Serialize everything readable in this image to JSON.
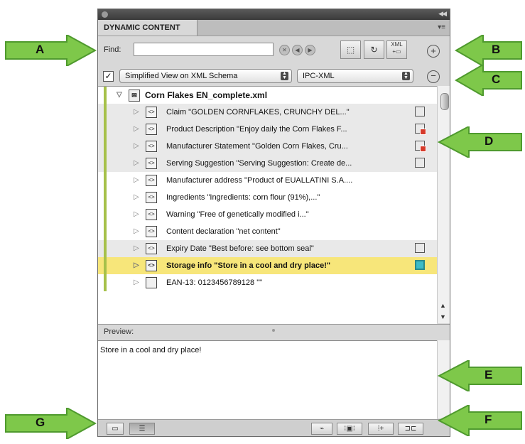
{
  "panel": {
    "tab_label": "DYNAMIC CONTENT",
    "menu_glyph": "▾≡",
    "find_label": "Find:",
    "find_value": "",
    "view_checked": true,
    "schema_view": "Simplified View on XML Schema",
    "format": "IPC-XML",
    "root_file": "Corn Flakes EN_complete.xml",
    "items": [
      {
        "label": "Claim  \"GOLDEN CORNFLAKES, CRUNCHY DEL...\"",
        "shaded": true,
        "frame": "empty",
        "bar": true
      },
      {
        "label": "Product Description  \"Enjoy daily the Corn Flakes F...",
        "shaded": true,
        "frame": "linked",
        "bar": true
      },
      {
        "label": "Manufacturer Statement  \"Golden Corn Flakes, Cru...",
        "shaded": true,
        "frame": "linked",
        "bar": true
      },
      {
        "label": "Serving Suggestion  \"Serving Suggestion: Create de...",
        "shaded": true,
        "frame": "empty",
        "bar": true
      },
      {
        "label": "Manufacturer address  \"Product of EUALLATINI S.A....",
        "shaded": false,
        "frame": "none",
        "bar": true
      },
      {
        "label": "Ingredients  \"Ingredients: corn flour (91%),...\"",
        "shaded": false,
        "frame": "none",
        "bar": true
      },
      {
        "label": "Warning  \"Free of genetically modified i...\"",
        "shaded": false,
        "frame": "none",
        "bar": true
      },
      {
        "label": "Content declaration  \"net content\"",
        "shaded": false,
        "frame": "none",
        "bar": true
      },
      {
        "label": "Expiry Date  \"Best before: see bottom seal\"",
        "shaded": true,
        "frame": "empty",
        "bar": true
      },
      {
        "label": "Storage info  \"Store in a cool and dry place!\"",
        "selected": true,
        "frame": "active",
        "bar": true
      },
      {
        "label": "EAN-13: 0123456789128  \"\"",
        "shaded": false,
        "frame": "none",
        "bar": true,
        "plain_tag": true
      }
    ],
    "preview_label": "Preview:",
    "preview_text": "Store in a cool and dry place!"
  },
  "callouts": {
    "a": "A",
    "b": "B",
    "c": "C",
    "d": "D",
    "e": "E",
    "f": "F",
    "g": "G"
  },
  "colors": {
    "arrow_green": "#7ec84a",
    "arrow_dark": "#4f9a2e",
    "status_bar": "#a6c14a",
    "selection": "#f7e67a"
  }
}
